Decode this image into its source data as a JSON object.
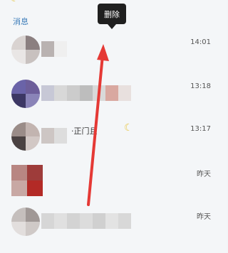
{
  "section": {
    "title": "消息"
  },
  "tooltip": {
    "label": "删除"
  },
  "messages": [
    {
      "time": "14:01",
      "snippet": ""
    },
    {
      "time": "13:18",
      "snippet": ""
    },
    {
      "time": "13:17",
      "snippet": "·正门且"
    },
    {
      "time": "昨天",
      "snippet": ""
    },
    {
      "time": "昨天",
      "snippet": ""
    }
  ],
  "colors": {
    "accent": "#3a7bb8",
    "arrow": "#e53935",
    "tooltip_bg": "#1f1f1f"
  },
  "icons": {
    "top": "crescent-moon-icon",
    "row3": "crescent-moon-icon"
  }
}
